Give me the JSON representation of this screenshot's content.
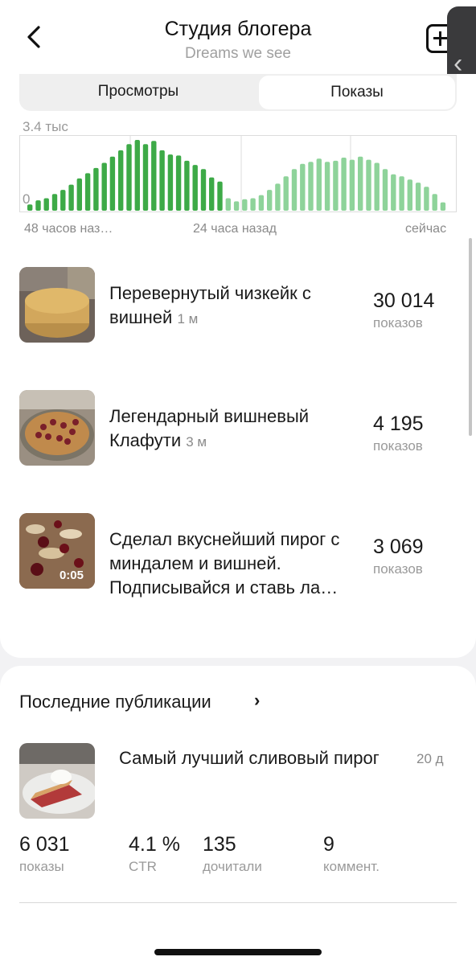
{
  "header": {
    "title": "Студия блогера",
    "subtitle": "Dreams we see"
  },
  "tabs": [
    {
      "label": "Просмотры",
      "active": false
    },
    {
      "label": "Показы",
      "active": true
    }
  ],
  "chart_data": {
    "type": "bar",
    "title": "",
    "y_max_label": "3.4 тыс",
    "y_min_label": "0",
    "ylim": [
      0,
      3400
    ],
    "x_labels": [
      "48 часов наз…",
      "24 часа назад",
      "сейчас"
    ],
    "series": [
      {
        "color": "#3daa47",
        "values": [
          300,
          500,
          600,
          800,
          1000,
          1250,
          1550,
          1800,
          2050,
          2300,
          2600,
          2900,
          3200,
          3400,
          3200,
          3350,
          2900,
          2700,
          2650,
          2400,
          2200,
          2000,
          1600,
          1400
        ]
      },
      {
        "color": "#8ed39a",
        "values": [
          600,
          450,
          550,
          600,
          750,
          1000,
          1300,
          1650,
          2000,
          2250,
          2350,
          2500,
          2350,
          2400,
          2550,
          2450,
          2600,
          2450,
          2300,
          2000,
          1750,
          1650,
          1500,
          1350,
          1150,
          800,
          400
        ]
      }
    ]
  },
  "top_publications": [
    {
      "title": "Перевернутый чизкейк с вишней",
      "age": "1 м",
      "value": "30 014",
      "unit": "показов",
      "duration": ""
    },
    {
      "title": "Легендарный вишневый Клафути",
      "age": "3 м",
      "value": "4 195",
      "unit": "показов",
      "duration": ""
    },
    {
      "title": "Сделал вкуснейший пирог с миндалем и вишней. Подписывайся и ставь ла…",
      "age": "",
      "value": "3 069",
      "unit": "показов",
      "duration": "0:05"
    }
  ],
  "recent": {
    "section_title": "Последние публикации",
    "title": "Самый лучший сливовый пирог",
    "age": "20 д",
    "stats": [
      {
        "value": "6 031",
        "label": "показы"
      },
      {
        "value": "4.1 %",
        "label": "CTR"
      },
      {
        "value": "135",
        "label": "дочитали"
      },
      {
        "value": "9",
        "label": "коммент."
      }
    ]
  },
  "icons": {
    "back": "chevron-left-icon",
    "add": "plus-square-icon",
    "section_chevron": "chevron-right-icon"
  },
  "colors": {
    "bar_dark": "#3daa47",
    "bar_light": "#8ed39a"
  }
}
